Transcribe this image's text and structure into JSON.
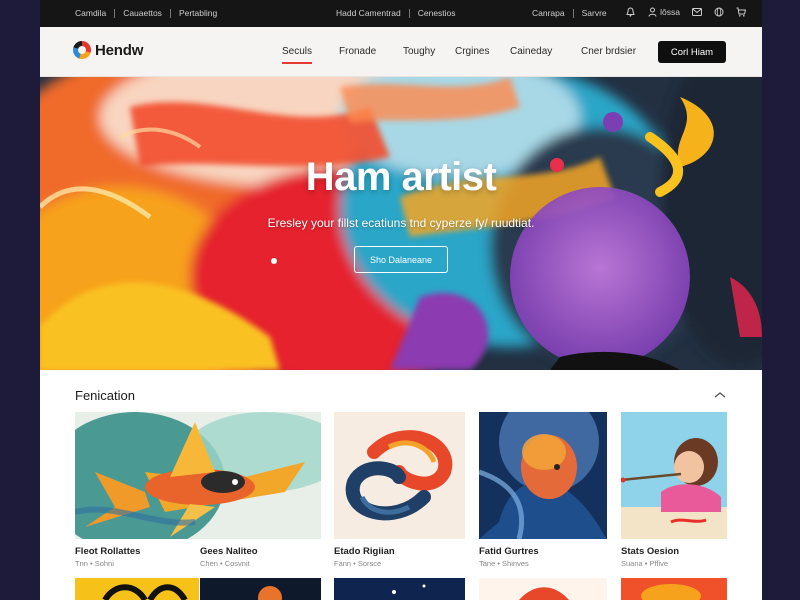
{
  "topbar": {
    "left_links": [
      "Camdila",
      "Cauaettos",
      "Pertabling"
    ],
    "mid_links": [
      "Hadd Camentrad",
      "Cenestios"
    ],
    "right_links": [
      "Canrapa",
      "Sarvre"
    ],
    "icons": [
      {
        "name": "bell-icon",
        "label": ""
      },
      {
        "name": "user-icon",
        "label": "lôssa"
      },
      {
        "name": "mail-icon",
        "label": ""
      },
      {
        "name": "globe-icon",
        "label": ""
      },
      {
        "name": "cart-icon",
        "label": ""
      }
    ]
  },
  "nav": {
    "logo_text": "Hendw",
    "items": [
      "Seculs",
      "Fronade",
      "Toughy",
      "Crgines",
      "Caineday",
      "Cner brdsier"
    ],
    "active_index": 0,
    "cta_label": "Corl Hiam"
  },
  "hero": {
    "title": "Ham artist",
    "subtitle": "Eresley your fillst ecatiuns tnd cyperze fy/ ruudtiat.",
    "button_label": "Sho Dalaneane"
  },
  "gallery": {
    "section_title": "Fenication",
    "cards": [
      {
        "title": "Fleot Rollattes",
        "meta": "Tnn • Sohni"
      },
      {
        "title": "Gees Naliteo",
        "meta": "Chen • Cosvnit"
      },
      {
        "title": "Etado Rigiian",
        "meta": "Fann • Sorsce"
      },
      {
        "title": "Fatid Gurtres",
        "meta": "Tane • Shinves"
      },
      {
        "title": "Stats Oesion",
        "meta": "Suana • Pffive"
      }
    ]
  },
  "colors": {
    "accent": "#e53935",
    "topbar_bg": "#151515",
    "nav_bg": "#f6f4f2",
    "cta_bg": "#0f0f0f",
    "page_bg": "#1e1a3a"
  }
}
